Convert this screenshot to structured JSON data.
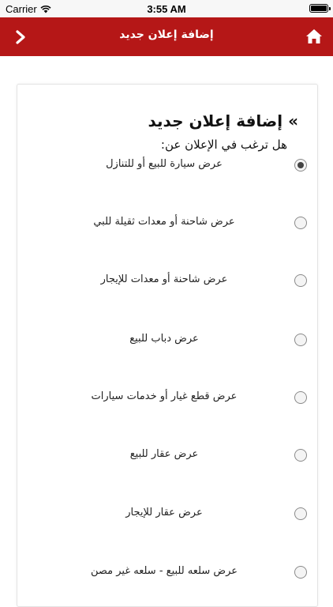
{
  "status_bar": {
    "carrier": "Carrier",
    "time": "3:55 AM"
  },
  "nav": {
    "title": "إضافة إعلان جديد"
  },
  "page": {
    "heading": "» إضافة إعلان جديد",
    "question": "هل ترغب في الإعلان عن:",
    "selected_index": 0,
    "options": [
      {
        "label": "عرض سيارة للبيع أو للتنازل",
        "checked": true
      },
      {
        "label": "عرض شاحنة أو معدات ثقيلة للبي",
        "checked": false
      },
      {
        "label": "عرض شاحنة أو معدات للإيجار",
        "checked": false
      },
      {
        "label": "عرض دباب للبيع",
        "checked": false
      },
      {
        "label": "عرض قطع غيار أو خدمات سيارات",
        "checked": false
      },
      {
        "label": "عرض عقار للبيع",
        "checked": false
      },
      {
        "label": "عرض عقار للإيجار",
        "checked": false
      },
      {
        "label": "عرض سلعه للبيع - سلعه غير مصن",
        "checked": false
      }
    ]
  },
  "colors": {
    "nav_bg": "#b51717",
    "nav_text": "#ffffff"
  }
}
